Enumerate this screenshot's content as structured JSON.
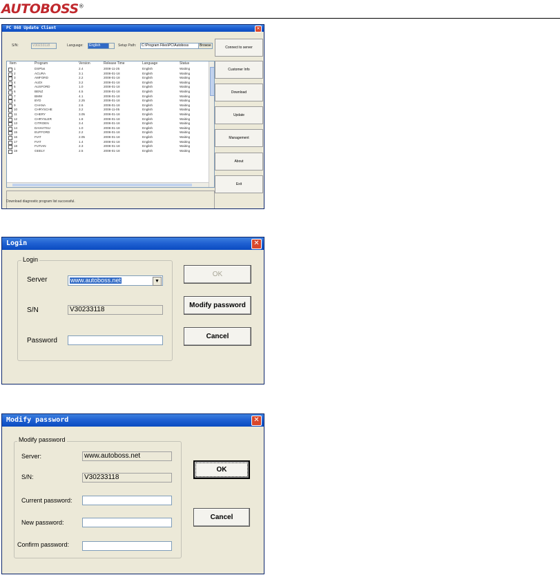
{
  "brand": {
    "logo_text": "AUTOBOSS",
    "reg_mark": "®"
  },
  "update_window": {
    "title": "PC 868 Update Client",
    "sn_label": "S/N:",
    "sn_value": "V30233118",
    "language_label": "Language:",
    "language_value": "English",
    "setup_path_label": "Setup Path:",
    "setup_path_value": "C:\\Program Files\\PC\\Autoboss",
    "browse_label": "Browse",
    "columns": [
      "Item",
      "Program",
      "Version",
      "Release Time",
      "Language",
      "Status"
    ],
    "rows": [
      [
        "1",
        "DSPlus",
        "2.4",
        "2008-11-25",
        "English",
        "Waiting"
      ],
      [
        "2",
        "ACURA",
        "3.1",
        "2008-01-18",
        "English",
        "Waiting"
      ],
      [
        "3",
        "AMFORD",
        "2.2",
        "2008-01-18",
        "English",
        "Waiting"
      ],
      [
        "4",
        "AUDI",
        "3.2",
        "2008-01-18",
        "English",
        "Waiting"
      ],
      [
        "5",
        "AUSFORD",
        "1.0",
        "2008-01-18",
        "English",
        "Waiting"
      ],
      [
        "6",
        "BENZ",
        "4.5",
        "2008-01-18",
        "English",
        "Waiting"
      ],
      [
        "7",
        "BMW",
        "4.1",
        "2008-01-18",
        "English",
        "Waiting"
      ],
      [
        "8",
        "BYD",
        "2.25",
        "2008-01-18",
        "English",
        "Waiting"
      ],
      [
        "9",
        "CHANA",
        "2.6",
        "2008-01-18",
        "English",
        "Waiting"
      ],
      [
        "10",
        "CHRYSCHE",
        "3.2",
        "2008-11-05",
        "English",
        "Waiting"
      ],
      [
        "11",
        "CHERY",
        "3.05",
        "2008-01-18",
        "English",
        "Waiting"
      ],
      [
        "12",
        "CHRYSLER",
        "1.8",
        "2008-01-18",
        "English",
        "Waiting"
      ],
      [
        "13",
        "CITROEN",
        "3.4",
        "2008-01-18",
        "English",
        "Waiting"
      ],
      [
        "14",
        "DAIHATSU",
        "1.0",
        "2008-01-18",
        "English",
        "Waiting"
      ],
      [
        "15",
        "EUFFORD",
        "2.2",
        "2008-01-18",
        "English",
        "Waiting"
      ],
      [
        "16",
        "FIAT",
        "2.05",
        "2008-01-18",
        "English",
        "Waiting"
      ],
      [
        "17",
        "FIAT",
        "1.4",
        "2008-01-18",
        "English",
        "Waiting"
      ],
      [
        "18",
        "FUTIAN",
        "2.3",
        "2008-01-18",
        "English",
        "Waiting"
      ],
      [
        "19",
        "GEELY",
        "2.5",
        "2008-01-18",
        "English",
        "Waiting"
      ]
    ],
    "buttons": [
      "Connect to server",
      "Customer Info",
      "Download",
      "Update",
      "Management",
      "About",
      "Exit"
    ],
    "status_text": "Download diagnostic program list successful."
  },
  "login_window": {
    "title": "Login",
    "group_label": "Login",
    "server_label": "Server",
    "server_value": "www.autoboss.net",
    "sn_label": "S/N",
    "sn_value": "V30233118",
    "password_label": "Password",
    "password_value": "",
    "ok_label": "OK",
    "modify_label": "Modify password",
    "cancel_label": "Cancel"
  },
  "modify_window": {
    "title": "Modify password",
    "group_label": "Modify password",
    "server_label": "Server:",
    "server_value": "www.autoboss.net",
    "sn_label": "S/N:",
    "sn_value": "V30233118",
    "current_label": "Current password:",
    "new_label": "New password:",
    "confirm_label": "Confirm password:",
    "ok_label": "OK",
    "cancel_label": "Cancel"
  },
  "colors": {
    "titlebar": "#0a4bc0",
    "window_bg": "#ece9d8",
    "logo": "#c0282d",
    "selection": "#316ac5"
  }
}
